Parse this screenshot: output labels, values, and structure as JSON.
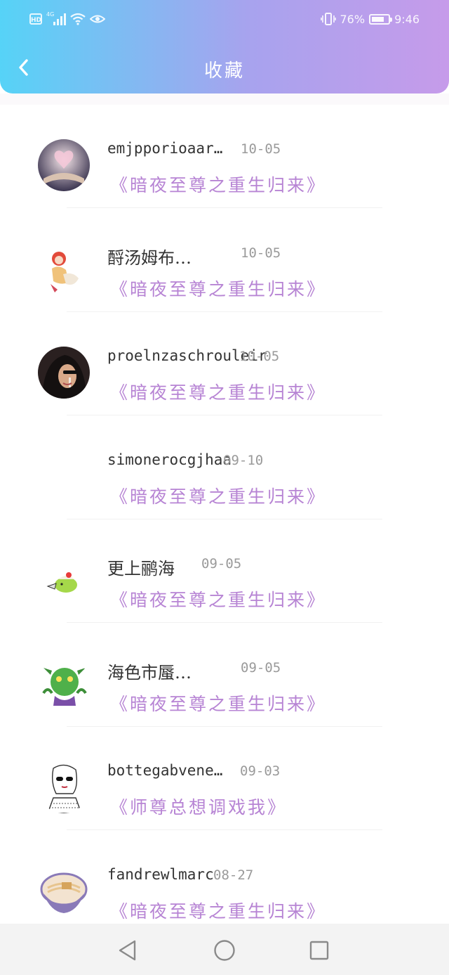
{
  "status_bar": {
    "hd_badge": "HD",
    "network": "4G",
    "battery_percent": "76%",
    "battery_level": 0.76,
    "time": "9:46",
    "icons": [
      "hd-icon",
      "signal-icon",
      "wifi-icon",
      "eye-icon",
      "vibrate-icon",
      "battery-icon"
    ]
  },
  "header": {
    "title": "收藏",
    "back_icon": "chevron-left-icon",
    "gradient_start": "#56d3f7",
    "gradient_end": "#c69bea"
  },
  "accent_color": "#b784d4",
  "favorites": [
    {
      "name": "emjpporioaar…",
      "date": "10-05",
      "book": "《暗夜至尊之重生归来》",
      "avatar": "book-art-avatar"
    },
    {
      "name": "酹汤姆布…",
      "date": "10-05",
      "book": "《暗夜至尊之重生归来》",
      "avatar": "anime-girl-avatar"
    },
    {
      "name": "proelnzaschrouleir",
      "date": "10-05",
      "book": "《暗夜至尊之重生归来》",
      "avatar": "woman-photo-avatar"
    },
    {
      "name": "simonerocgjhaa",
      "date": "09-10",
      "book": "《暗夜至尊之重生归来》",
      "avatar": "blank-avatar"
    },
    {
      "name": "更上鹂海",
      "date": "09-05",
      "book": "《暗夜至尊之重生归来》",
      "avatar": "bird-sticker-avatar"
    },
    {
      "name": "海色市蜃…",
      "date": "09-05",
      "book": "《暗夜至尊之重生归来》",
      "avatar": "green-monster-avatar"
    },
    {
      "name": "bottegabvene…",
      "date": "09-03",
      "book": "《师尊总想调戏我》",
      "avatar": "sketch-girl-avatar"
    },
    {
      "name": "fandrewlmarc",
      "date": "08-27",
      "book": "《暗夜至尊之重生归来》",
      "avatar": "noodle-bowl-avatar"
    }
  ],
  "nav_bar": {
    "icons": [
      "back-triangle-icon",
      "home-circle-icon",
      "recents-square-icon"
    ]
  }
}
